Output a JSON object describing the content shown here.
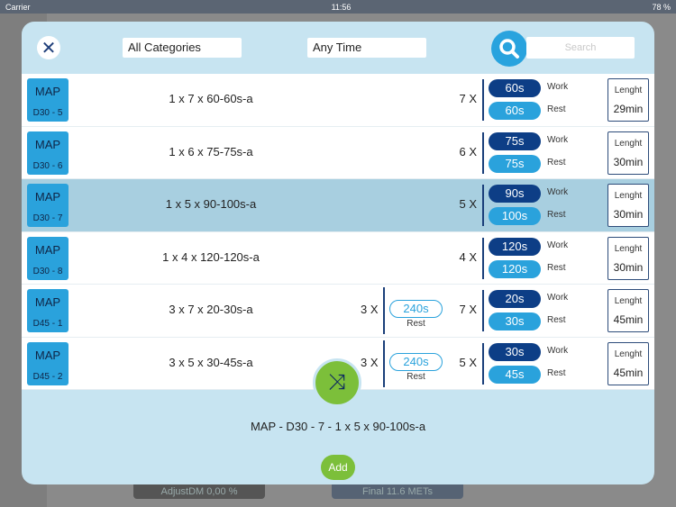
{
  "status": {
    "carrier": "Carrier",
    "time": "11:56",
    "battery": "78 %"
  },
  "background": {
    "adjust": "AdjustDM 0,00 %",
    "final": "Final 11.6 METs"
  },
  "header": {
    "category": "All Categories",
    "time_filter": "Any Time",
    "search_placeholder": "Search"
  },
  "rows": [
    {
      "type": "MAP",
      "code": "D30 - 5",
      "name": "1 x 7 x 60-60s-a",
      "reps": "7 X",
      "work": "60s",
      "rest": "60s",
      "length_label": "Lenght",
      "length": "29min"
    },
    {
      "type": "MAP",
      "code": "D30 - 6",
      "name": "1 x 6 x 75-75s-a",
      "reps": "6 X",
      "work": "75s",
      "rest": "75s",
      "length_label": "Lenght",
      "length": "30min"
    },
    {
      "type": "MAP",
      "code": "D30 - 7",
      "name": "1 x 5 x 90-100s-a",
      "reps": "5 X",
      "work": "90s",
      "rest": "100s",
      "length_label": "Lenght",
      "length": "30min"
    },
    {
      "type": "MAP",
      "code": "D30 - 8",
      "name": "1 x 4 x 120-120s-a",
      "reps": "4 X",
      "work": "120s",
      "rest": "120s",
      "length_label": "Lenght",
      "length": "30min"
    },
    {
      "type": "MAP",
      "code": "D45 - 1",
      "name": "3 x 7 x 20-30s-a",
      "sets": "3 X",
      "set_rest": "240s",
      "set_rest_label": "Rest",
      "reps": "7 X",
      "work": "20s",
      "rest": "30s",
      "length_label": "Lenght",
      "length": "45min"
    },
    {
      "type": "MAP",
      "code": "D45 - 2",
      "name": "3 x 5 x 30-45s-a",
      "sets": "3 X",
      "set_rest": "240s",
      "set_rest_label": "Rest",
      "reps": "5 X",
      "work": "30s",
      "rest": "45s",
      "length_label": "Lenght",
      "length": "45min"
    }
  ],
  "labels": {
    "work": "Work",
    "rest": "Rest"
  },
  "selected": "MAP - D30 - 7 - 1 x 5 x 90-100s-a",
  "add_label": "Add"
}
